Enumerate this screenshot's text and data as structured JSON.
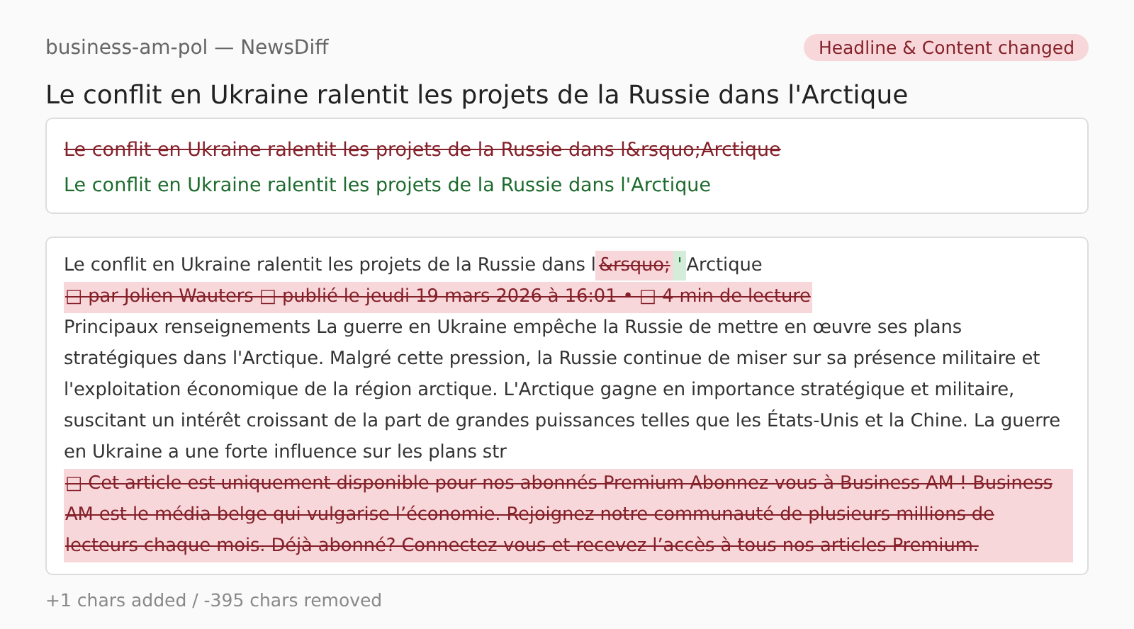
{
  "header": {
    "source": "business-am-pol — NewsDiff",
    "badge": "Headline & Content changed"
  },
  "headline": "Le conflit en Ukraine ralentit les projets de la Russie dans l'Arctique",
  "headline_diff": [
    {
      "kind": "removed",
      "text": "Le conflit en Ukraine ralentit les projets de la Russie dans l&rsquo;Arctique"
    },
    {
      "kind": "added",
      "text": "Le conflit en Ukraine ralentit les projets de la Russie dans l'Arctique"
    }
  ],
  "content_diff": [
    [
      {
        "kind": "same",
        "text": "Le conflit en Ukraine ralentit les projets de la Russie dans l"
      },
      {
        "kind": "removed",
        "text": "&rsquo;"
      },
      {
        "kind": "added",
        "text": "'"
      },
      {
        "kind": "same",
        "text": "Arctique"
      }
    ],
    [
      {
        "kind": "removed",
        "text": "□ par Jolien Wauters □ publié le jeudi 19 mars 2026 à 16:01 • □ 4 min de lecture"
      }
    ],
    [
      {
        "kind": "same",
        "text": "Principaux renseignements La guerre en Ukraine empêche la Russie de mettre en œuvre ses plans stratégiques dans l'Arctique. Malgré cette pression, la Russie continue de miser sur sa présence militaire et l'exploitation économique de la région arctique. L'Arctique gagne en importance stratégique et militaire, suscitant un intérêt croissant de la part de grandes puissances telles que les États-Unis et la Chine. La guerre en Ukraine a une forte influence sur les plans str"
      }
    ],
    [
      {
        "kind": "removed",
        "text": "□ Cet article est uniquement disponible pour nos abonnés Premium Abonnez-vous à Business AM ! Business AM est le média belge qui vulgarise l’économie. Rejoignez notre communauté de plusieurs millions de lecteurs chaque mois. Déjà abonné? Connectez-vous et recevez l’accès à tous nos articles Premium."
      }
    ]
  ],
  "summary": "+1 chars added / -395 chars removed"
}
